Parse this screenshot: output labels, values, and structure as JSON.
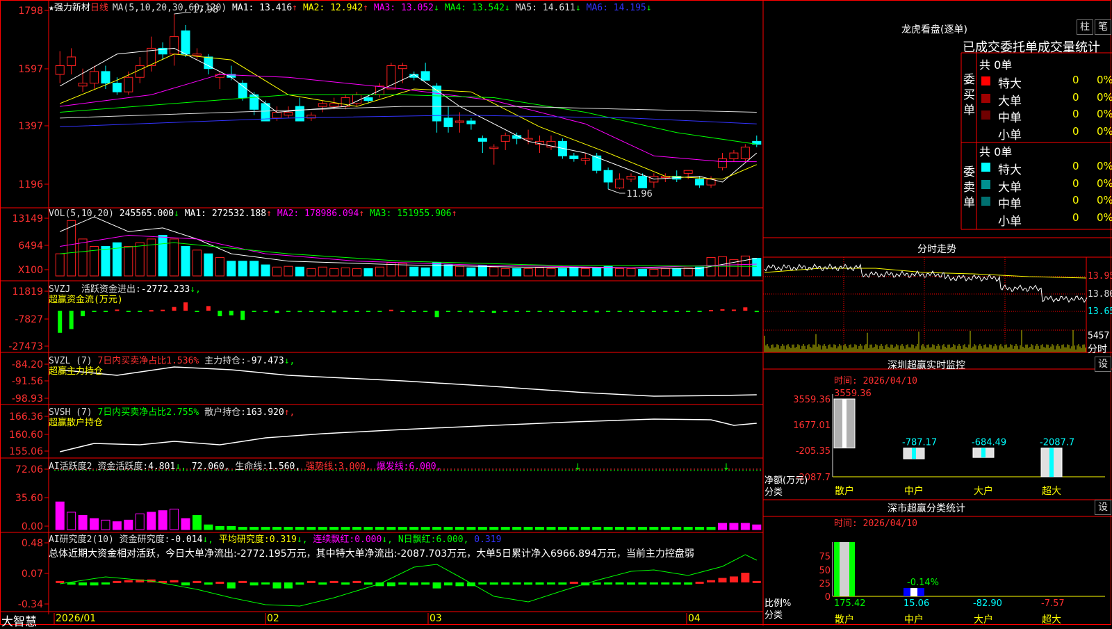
{
  "stock": {
    "title": "★强力新材",
    "period": "日线"
  },
  "ma_bar": {
    "label": "MA(5,10,20,30,60,120)",
    "items": [
      {
        "name": "MA1:",
        "value": "13.416",
        "arrow": "↑",
        "color": "#ffffff"
      },
      {
        "name": "MA2:",
        "value": "12.942",
        "arrow": "↑",
        "color": "#ffff00"
      },
      {
        "name": "MA3:",
        "value": "13.052",
        "arrow": "↓",
        "color": "#ff00ff"
      },
      {
        "name": "MA4:",
        "value": "13.542",
        "arrow": "↓",
        "color": "#00ff00"
      },
      {
        "name": "MA5:",
        "value": "14.611",
        "arrow": "↓",
        "color": "#dddddd"
      },
      {
        "name": "MA6:",
        "value": "14.195",
        "arrow": "↓",
        "color": "#3333ff"
      }
    ]
  },
  "vol_bar": {
    "label": "VOL(5,10,20)",
    "value": "245565.000",
    "arrow": "↓",
    "items": [
      {
        "name": "MA1:",
        "value": "272532.188",
        "arrow": "↑",
        "color": "#ffffff"
      },
      {
        "name": "MA2:",
        "value": "178986.094",
        "arrow": "↑",
        "color": "#ff00ff"
      },
      {
        "name": "MA3:",
        "value": "151955.906",
        "arrow": "↑",
        "color": "#00ff00"
      }
    ]
  },
  "svzj_bar": {
    "label": "SVZJ",
    "text": "活跃资金进出:",
    "value": "-2772.233",
    "arrow": "↓,",
    "sub": "超赢资金流(万元)"
  },
  "svzl_bar": {
    "label": "SVZL (7)",
    "text1": "7日内买卖净占比1.536%",
    "text2": "主力持仓:",
    "value": "-97.473",
    "arrow": "↓,",
    "sub": "超赢主力持仓"
  },
  "svsh_bar": {
    "label": "SVSH (7)",
    "text1": "7日内买卖净占比2.755%",
    "text2": "散户持仓:",
    "value": "163.920",
    "arrow": "↑,",
    "sub": "超赢散户持仓"
  },
  "ai_bar": {
    "label": "AI活跃度2",
    "text1": "资金活跃度:",
    "v1": "4.801",
    "v2": "72.060,",
    "text2": "生命线:",
    "v3": "1.560,",
    "text3": "强势线:",
    "v4": "3.000,",
    "text4": "爆发线:",
    "v5": "6.000,"
  },
  "ai2_bar": {
    "label": "AI研究度2(10)",
    "text1": "资金研究度:",
    "v1": "-0.014",
    "text2": "平均研究度:",
    "v2": "0.319",
    "text3": "连续飘红:",
    "v3": "0.000",
    "text4": "N日飘红:",
    "v4": "6.000,",
    "v5": "0.319",
    "summary": "总体近期大资金相对活跃，今日大单净流出:-2772.195万元，其中特大单净流出:-2087.703万元，大单5日累计净入6966.894万元，当前主力控盘弱"
  },
  "bottom": {
    "brand": "大智慧",
    "dates": [
      "2026/01",
      "02",
      "03",
      "04"
    ]
  },
  "colors": {
    "up": "#ff2020",
    "down": "#00ffff",
    "grid": "#ff0000",
    "axis": "#ff3030"
  },
  "right": {
    "dragon": {
      "title": "龙虎看盘(逐单)",
      "btn1": "柱",
      "btn2": "笔",
      "subtitle": "已成交委托单成交量统计",
      "buy": {
        "side": "委买单",
        "total": "共 0单",
        "rows": [
          {
            "name": "特大",
            "n": "0",
            "p": "0%"
          },
          {
            "name": "大单",
            "n": "0",
            "p": "0%"
          },
          {
            "name": "中单",
            "n": "0",
            "p": "0%"
          },
          {
            "name": "小单",
            "n": "0",
            "p": "0%"
          }
        ]
      },
      "sell": {
        "side": "委卖单",
        "total": "共 0单",
        "rows": [
          {
            "name": "特大",
            "n": "0",
            "p": "0%"
          },
          {
            "name": "大单",
            "n": "0",
            "p": "0%"
          },
          {
            "name": "中单",
            "n": "0",
            "p": "0%"
          },
          {
            "name": "小单",
            "n": "0",
            "p": "0%"
          }
        ]
      }
    },
    "intraday": {
      "title": "分时走势",
      "prices": [
        "13.95",
        "13.80",
        "13.65"
      ],
      "vol": "5457",
      "vol_unit": "分时"
    },
    "monitor": {
      "title": "深圳超赢实时监控",
      "btn": "设",
      "time": "时间: 2026/04/10",
      "yaxis": [
        "3559.36",
        "1677.01",
        "-205.35",
        "-2087.7"
      ],
      "ylabel": "净额(万元)",
      "xlabel": "分类",
      "cats": [
        "散户",
        "中户",
        "大户",
        "超大"
      ],
      "values": [
        3559.36,
        -787.17,
        -684.49,
        -2087.7
      ],
      "labels": [
        "3559.36",
        "-787.17",
        "-684.49",
        "-2087.7"
      ]
    },
    "classify": {
      "title": "深市超赢分类统计",
      "btn": "设",
      "time": "时间: 2026/04/10",
      "yaxis": [
        "75",
        "50",
        "25",
        "0"
      ],
      "ylabel": "比例%",
      "xlabel": "分类",
      "cats": [
        "散户",
        "中户",
        "大户",
        "超大"
      ],
      "values": [
        175.42,
        15.06,
        -82.9,
        -7.57
      ],
      "labels": [
        "175.42",
        "15.06",
        "-82.90",
        "-7.57"
      ],
      "mid_label": "-0.14%"
    }
  },
  "chart_data": [
    {
      "type": "candlestick",
      "name": "日线",
      "yaxis": [
        "1798",
        "1597",
        "1397",
        "1196"
      ],
      "annotations": [
        "17.98",
        "11.96"
      ],
      "ohlc": [
        [
          15.9,
          16.7,
          15.6,
          16.2
        ],
        [
          16.2,
          16.8,
          15.9,
          16.5
        ],
        [
          15.5,
          16.1,
          15.3,
          15.6
        ],
        [
          15.6,
          16.2,
          15.4,
          16.0
        ],
        [
          16.0,
          16.2,
          15.4,
          15.6
        ],
        [
          15.6,
          15.8,
          15.2,
          15.3
        ],
        [
          15.3,
          16.0,
          15.2,
          15.8
        ],
        [
          15.8,
          16.5,
          15.6,
          16.2
        ],
        [
          16.2,
          17.2,
          16.0,
          16.8
        ],
        [
          16.8,
          17.0,
          16.4,
          16.6
        ],
        [
          16.6,
          17.98,
          16.2,
          17.2
        ],
        [
          17.4,
          17.6,
          16.5,
          16.6
        ],
        [
          16.6,
          16.8,
          16.4,
          16.6
        ],
        [
          16.5,
          16.6,
          15.9,
          16.1
        ],
        [
          15.8,
          16.0,
          15.4,
          15.9
        ],
        [
          15.9,
          16.2,
          15.7,
          15.8
        ],
        [
          15.6,
          15.7,
          15.0,
          15.1
        ],
        [
          15.2,
          15.3,
          14.5,
          14.7
        ],
        [
          14.9,
          15.0,
          14.3,
          14.3
        ],
        [
          14.4,
          14.8,
          14.3,
          14.6
        ],
        [
          14.5,
          14.8,
          14.4,
          14.6
        ],
        [
          14.8,
          15.1,
          14.3,
          14.3
        ],
        [
          14.4,
          14.6,
          14.3,
          14.5
        ],
        [
          14.8,
          15.0,
          14.6,
          14.9
        ],
        [
          14.8,
          15.1,
          14.7,
          14.9
        ],
        [
          14.8,
          15.2,
          14.7,
          15.1
        ],
        [
          14.9,
          15.3,
          14.8,
          15.2
        ],
        [
          15.1,
          15.2,
          14.9,
          15.0
        ],
        [
          15.2,
          15.6,
          15.1,
          15.5
        ],
        [
          15.4,
          16.3,
          15.4,
          16.2
        ],
        [
          16.1,
          16.3,
          15.6,
          16.2
        ],
        [
          15.9,
          16.0,
          15.7,
          15.8
        ],
        [
          16.0,
          16.3,
          15.7,
          15.7
        ],
        [
          15.5,
          15.6,
          13.9,
          14.3
        ],
        [
          14.4,
          14.8,
          13.9,
          14.1
        ],
        [
          14.3,
          14.6,
          13.9,
          14.3
        ],
        [
          14.3,
          14.4,
          14.0,
          14.2
        ],
        [
          13.7,
          13.8,
          13.2,
          13.6
        ],
        [
          13.4,
          13.5,
          12.8,
          13.4
        ],
        [
          13.6,
          13.9,
          13.3,
          13.8
        ],
        [
          13.8,
          13.9,
          13.5,
          13.7
        ],
        [
          13.7,
          14.0,
          13.5,
          13.7
        ],
        [
          13.5,
          13.8,
          13.2,
          13.6
        ],
        [
          13.4,
          13.8,
          13.3,
          13.6
        ],
        [
          13.6,
          13.7,
          13.0,
          13.1
        ],
        [
          13.1,
          13.2,
          12.9,
          13.0
        ],
        [
          13.0,
          13.2,
          12.8,
          13.0
        ],
        [
          13.1,
          13.2,
          12.5,
          12.6
        ],
        [
          12.6,
          12.7,
          11.96,
          12.2
        ],
        [
          12.0,
          12.5,
          11.96,
          12.3
        ],
        [
          12.3,
          12.5,
          12.2,
          12.4
        ],
        [
          12.4,
          12.5,
          12.0,
          12.0
        ],
        [
          12.2,
          12.5,
          12.0,
          12.4
        ],
        [
          12.4,
          12.5,
          12.2,
          12.4
        ],
        [
          12.4,
          12.6,
          12.2,
          12.3
        ],
        [
          12.5,
          12.6,
          12.3,
          12.6
        ],
        [
          12.3,
          12.4,
          12.0,
          12.1
        ],
        [
          12.1,
          12.4,
          12.0,
          12.3
        ],
        [
          12.7,
          13.2,
          12.6,
          13.0
        ],
        [
          13.0,
          13.3,
          12.9,
          13.2
        ],
        [
          13.0,
          13.5,
          12.9,
          13.4
        ],
        [
          13.6,
          13.8,
          13.4,
          13.5
        ]
      ],
      "ma_series": [
        {
          "name": "MA1",
          "color": "#ffffff",
          "points": [
            [
              0,
              15.5
            ],
            [
              5,
              16.6
            ],
            [
              10,
              16.8
            ],
            [
              15,
              15.8
            ],
            [
              19,
              14.6
            ],
            [
              25,
              14.8
            ],
            [
              31,
              15.9
            ],
            [
              35,
              14.8
            ],
            [
              41,
              13.6
            ],
            [
              46,
              13.2
            ],
            [
              52,
              12.3
            ],
            [
              56,
              12.4
            ],
            [
              58,
              12.2
            ],
            [
              61,
              13.2
            ]
          ]
        },
        {
          "name": "MA2",
          "color": "#ffff00",
          "points": [
            [
              0,
              14.9
            ],
            [
              5,
              15.7
            ],
            [
              10,
              16.6
            ],
            [
              15,
              16.4
            ],
            [
              20,
              15.2
            ],
            [
              26,
              14.8
            ],
            [
              31,
              15.4
            ],
            [
              36,
              15.3
            ],
            [
              42,
              14.1
            ],
            [
              48,
              13.2
            ],
            [
              53,
              12.4
            ],
            [
              58,
              12.3
            ],
            [
              61,
              12.8
            ]
          ]
        },
        {
          "name": "MA3",
          "color": "#ff00ff",
          "points": [
            [
              0,
              14.8
            ],
            [
              8,
              15.2
            ],
            [
              14,
              15.9
            ],
            [
              20,
              15.8
            ],
            [
              30,
              15.4
            ],
            [
              38,
              15.0
            ],
            [
              46,
              14.2
            ],
            [
              52,
              13.1
            ],
            [
              58,
              12.9
            ],
            [
              61,
              12.9
            ]
          ]
        },
        {
          "name": "MA4",
          "color": "#00ff00",
          "points": [
            [
              0,
              14.6
            ],
            [
              10,
              14.9
            ],
            [
              20,
              15.2
            ],
            [
              30,
              15.2
            ],
            [
              38,
              15.1
            ],
            [
              46,
              14.6
            ],
            [
              54,
              13.9
            ],
            [
              61,
              13.5
            ]
          ]
        },
        {
          "name": "MA5",
          "color": "#dddddd",
          "points": [
            [
              0,
              14.4
            ],
            [
              15,
              14.6
            ],
            [
              30,
              14.8
            ],
            [
              40,
              14.8
            ],
            [
              50,
              14.7
            ],
            [
              61,
              14.6
            ]
          ]
        },
        {
          "name": "MA6",
          "color": "#3333ff",
          "points": [
            [
              0,
              14.1
            ],
            [
              20,
              14.4
            ],
            [
              35,
              14.5
            ],
            [
              50,
              14.4
            ],
            [
              61,
              14.2
            ]
          ]
        }
      ]
    },
    {
      "type": "bar",
      "name": "VOL",
      "yaxis": [
        "13149",
        "6494",
        "X100"
      ],
      "values": [
        3,
        7.5,
        5,
        4,
        4,
        4.5,
        4,
        4.5,
        5,
        5.5,
        5,
        4,
        3.5,
        3,
        2.5,
        2,
        2,
        2,
        1.5,
        1.2,
        1.3,
        1.2,
        1,
        1.2,
        1,
        1.1,
        1,
        1,
        1.2,
        1.8,
        1.7,
        1.2,
        1.1,
        1.8,
        1.5,
        1.3,
        1.1,
        1.4,
        1.2,
        1,
        1,
        1,
        1.1,
        1,
        1,
        1.2,
        1,
        1.1,
        1.3,
        1,
        1,
        0.9,
        0.9,
        1,
        1,
        1.1,
        1.2,
        2.5,
        2.6,
        2.2,
        2.7,
        2.4
      ]
    },
    {
      "type": "bar",
      "name": "SVZJ",
      "yaxis": [
        "11819",
        "-7827",
        "-27473"
      ],
      "values": [
        -12000,
        -10000,
        -3000,
        -500,
        -200,
        600,
        -300,
        -400,
        300,
        500,
        2000,
        4500,
        -300,
        2500,
        -3000,
        -2500,
        -5000,
        -500,
        -700,
        -1200,
        -600,
        -800,
        -600,
        -400,
        -900,
        -300,
        -700,
        -400,
        -600,
        500,
        -300,
        -600,
        -200,
        -3500,
        -400,
        -500,
        -900,
        -400,
        -1200,
        -600,
        -500,
        -700,
        -300,
        -500,
        -300,
        -400,
        -500,
        -900,
        -500,
        -400,
        -300,
        -500,
        -400,
        -300,
        -700,
        -400,
        -500,
        400,
        800,
        600,
        1800,
        -800
      ]
    },
    {
      "type": "line",
      "name": "SVZL",
      "yaxis": [
        "-84.20",
        "-91.56",
        "-98.93"
      ]
    },
    {
      "type": "line",
      "name": "SVSH",
      "yaxis": [
        "166.36",
        "160.60",
        "155.06"
      ]
    },
    {
      "type": "bar",
      "name": "AI活跃度2",
      "yaxis": [
        "72.06",
        "35.60",
        "0.00"
      ],
      "values": [
        35,
        22,
        18,
        14,
        12,
        10,
        12,
        20,
        22,
        24,
        26,
        14,
        18,
        6,
        4,
        4,
        3,
        3,
        3,
        3,
        3,
        3,
        3,
        3,
        3,
        3,
        3,
        3,
        3,
        3,
        3,
        3,
        3,
        3,
        3,
        3,
        3,
        3,
        3,
        3,
        3,
        3,
        3,
        3,
        3,
        3,
        3,
        3,
        3,
        3,
        3,
        3,
        3,
        3,
        3,
        3,
        3,
        3,
        8,
        8,
        8,
        6
      ]
    },
    {
      "type": "bar",
      "name": "AI研究度2",
      "yaxis": [
        "0.48",
        "0.07",
        "-0.34"
      ],
      "values": [
        0.02,
        -0.03,
        -0.04,
        -0.04,
        -0.02,
        0.02,
        0.03,
        0.04,
        0.04,
        0.02,
        0.03,
        -0.04,
        0.02,
        -0.03,
        0.01,
        -0.08,
        0.02,
        -0.04,
        -0.02,
        -0.08,
        -0.08,
        -0.03,
        0.02,
        -0.03,
        0.02,
        -0.03,
        0.02,
        -0.03,
        -0.05,
        -0.05,
        -0.03,
        -0.04,
        -0.03,
        -0.08,
        -0.04,
        -0.05,
        -0.05,
        -0.02,
        -0.03,
        -0.03,
        -0.02,
        -0.03,
        -0.03,
        -0.02,
        -0.03,
        0.01,
        -0.04,
        -0.03,
        -0.02,
        -0.02,
        -0.03,
        -0.02,
        -0.02,
        -0.02,
        -0.02,
        -0.03,
        0.01,
        0.03,
        0.06,
        0.08,
        0.13,
        0.02
      ]
    }
  ]
}
